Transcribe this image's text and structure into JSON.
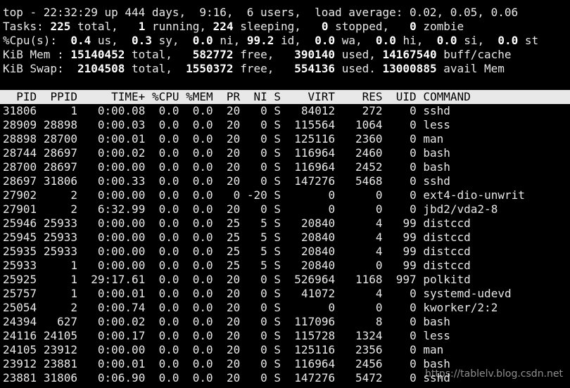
{
  "summary": {
    "line1": "top - 22:32:29 up 444 days,  9:16,  6 users,  load average: 0.02, 0.05, 0.06",
    "tasks": {
      "label": "Tasks:",
      "total": "225",
      "total_label": "total,",
      "running": "1",
      "running_label": "running,",
      "sleeping": "224",
      "sleeping_label": "sleeping,",
      "stopped": "0",
      "stopped_label": "stopped,",
      "zombie": "0",
      "zombie_label": "zombie"
    },
    "cpu": {
      "label": "%Cpu(s):",
      "us": "0.4",
      "us_label": "us,",
      "sy": "0.3",
      "sy_label": "sy,",
      "ni": "0.0",
      "ni_label": "ni,",
      "id": "99.2",
      "id_label": "id,",
      "wa": "0.0",
      "wa_label": "wa,",
      "hi": "0.0",
      "hi_label": "hi,",
      "si": "0.0",
      "si_label": "si,",
      "st": "0.0",
      "st_label": "st"
    },
    "mem": {
      "label": "KiB Mem :",
      "total": "15140452",
      "total_label": "total,",
      "free": "582772",
      "free_label": "free,",
      "used": "390140",
      "used_label": "used,",
      "buff": "14167540",
      "buff_label": "buff/cache"
    },
    "swap": {
      "label": "KiB Swap:",
      "total": "2104508",
      "total_label": "total,",
      "free": "1550372",
      "free_label": "free,",
      "used": "554136",
      "used_label": "used.",
      "avail": "13000885",
      "avail_label": "avail Mem"
    }
  },
  "table": {
    "columns": [
      "PID",
      "PPID",
      "TIME+",
      "%CPU",
      "%MEM",
      "PR",
      "NI",
      "S",
      "VIRT",
      "RES",
      "UID",
      "COMMAND"
    ],
    "rows": [
      [
        "31806",
        "1",
        "0:00.08",
        "0.0",
        "0.0",
        "20",
        "0",
        "S",
        "84012",
        "272",
        "0",
        "sshd"
      ],
      [
        "28909",
        "28898",
        "0:00.03",
        "0.0",
        "0.0",
        "20",
        "0",
        "S",
        "115564",
        "1064",
        "0",
        "less"
      ],
      [
        "28898",
        "28700",
        "0:00.01",
        "0.0",
        "0.0",
        "20",
        "0",
        "S",
        "125116",
        "2360",
        "0",
        "man"
      ],
      [
        "28744",
        "28697",
        "0:00.02",
        "0.0",
        "0.0",
        "20",
        "0",
        "S",
        "116964",
        "2460",
        "0",
        "bash"
      ],
      [
        "28700",
        "28697",
        "0:00.00",
        "0.0",
        "0.0",
        "20",
        "0",
        "S",
        "116964",
        "2452",
        "0",
        "bash"
      ],
      [
        "28697",
        "31806",
        "0:00.33",
        "0.0",
        "0.0",
        "20",
        "0",
        "S",
        "147276",
        "5468",
        "0",
        "sshd"
      ],
      [
        "27902",
        "2",
        "0:00.00",
        "0.0",
        "0.0",
        "0",
        "-20",
        "S",
        "0",
        "0",
        "0",
        "ext4-dio-unwrit"
      ],
      [
        "27901",
        "2",
        "6:32.99",
        "0.0",
        "0.0",
        "20",
        "0",
        "S",
        "0",
        "0",
        "0",
        "jbd2/vda2-8"
      ],
      [
        "25946",
        "25933",
        "0:00.00",
        "0.0",
        "0.0",
        "25",
        "5",
        "S",
        "20840",
        "4",
        "99",
        "distccd"
      ],
      [
        "25945",
        "25933",
        "0:00.00",
        "0.0",
        "0.0",
        "25",
        "5",
        "S",
        "20840",
        "4",
        "99",
        "distccd"
      ],
      [
        "25935",
        "25933",
        "0:00.00",
        "0.0",
        "0.0",
        "25",
        "5",
        "S",
        "20840",
        "4",
        "99",
        "distccd"
      ],
      [
        "25933",
        "1",
        "0:00.00",
        "0.0",
        "0.0",
        "25",
        "5",
        "S",
        "20840",
        "0",
        "99",
        "distccd"
      ],
      [
        "25925",
        "1",
        "29:17.61",
        "0.0",
        "0.0",
        "20",
        "0",
        "S",
        "526964",
        "1168",
        "997",
        "polkitd"
      ],
      [
        "25757",
        "1",
        "0:00.01",
        "0.0",
        "0.0",
        "20",
        "0",
        "S",
        "41072",
        "4",
        "0",
        "systemd-udevd"
      ],
      [
        "25054",
        "2",
        "0:00.74",
        "0.0",
        "0.0",
        "20",
        "0",
        "S",
        "0",
        "0",
        "0",
        "kworker/2:2"
      ],
      [
        "24394",
        "627",
        "0:00.02",
        "0.0",
        "0.0",
        "20",
        "0",
        "S",
        "117096",
        "8",
        "0",
        "bash"
      ],
      [
        "24116",
        "24105",
        "0:00.17",
        "0.0",
        "0.0",
        "20",
        "0",
        "S",
        "115728",
        "1324",
        "0",
        "less"
      ],
      [
        "24105",
        "23912",
        "0:00.00",
        "0.0",
        "0.0",
        "20",
        "0",
        "S",
        "125116",
        "2356",
        "0",
        "man"
      ],
      [
        "23912",
        "23881",
        "0:00.01",
        "0.0",
        "0.0",
        "20",
        "0",
        "S",
        "116964",
        "2456",
        "0",
        "bash"
      ],
      [
        "23881",
        "31806",
        "0:06.90",
        "0.0",
        "0.0",
        "20",
        "0",
        "S",
        "147276",
        "5472",
        "0",
        "sshd"
      ]
    ]
  },
  "watermark": "https://tablelv.blog.csdn.net"
}
